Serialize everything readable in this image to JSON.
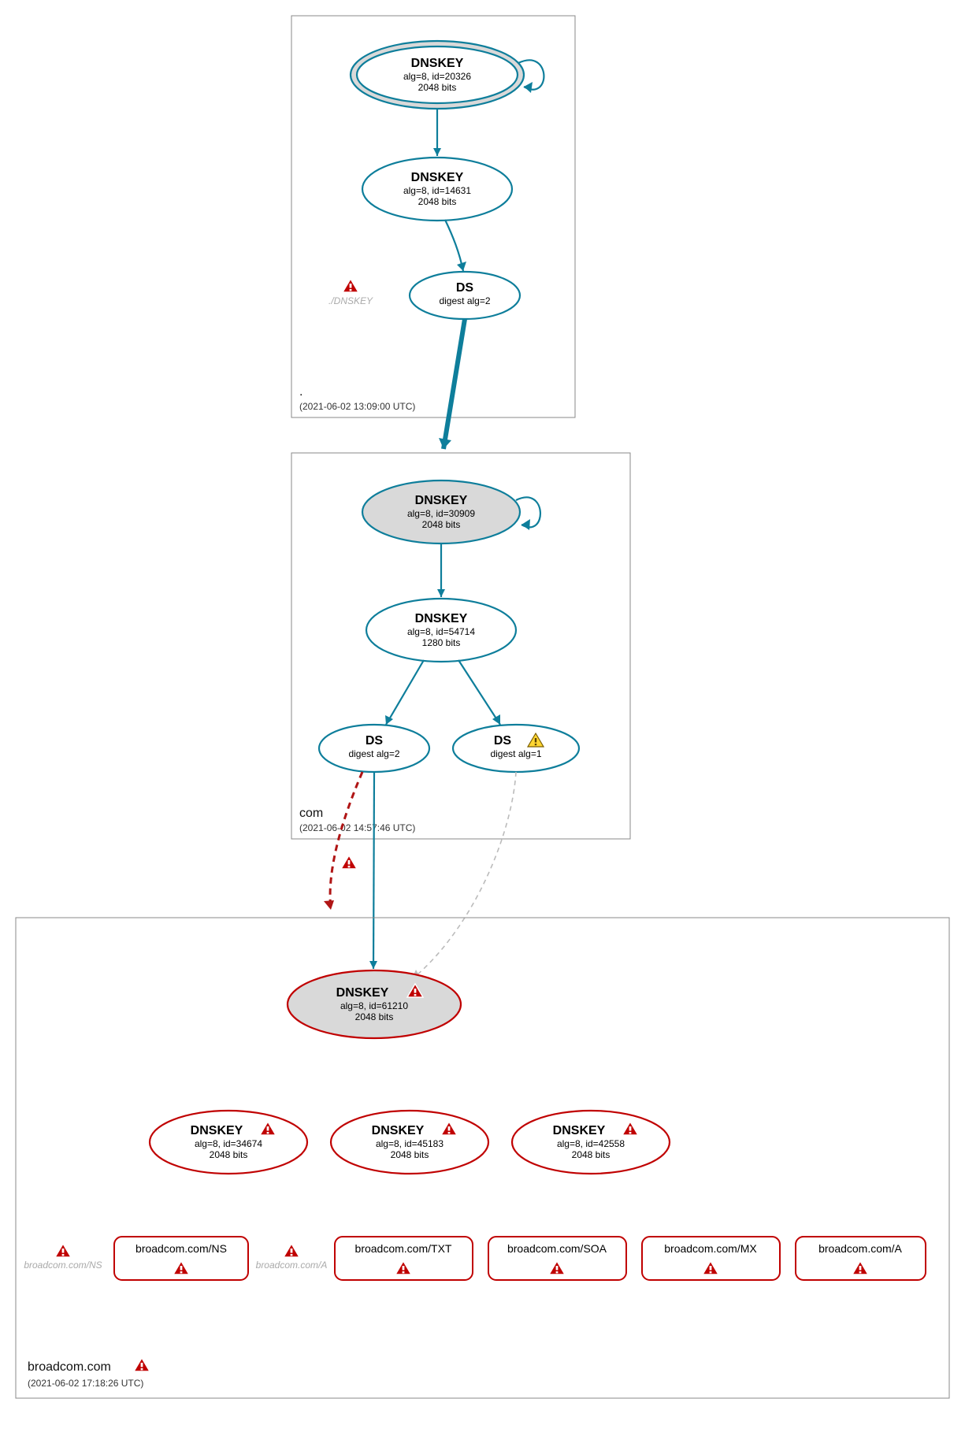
{
  "zones": {
    "root": {
      "name": ".",
      "timestamp": "(2021-06-02 13:09:00 UTC)",
      "nodes": {
        "ksk": {
          "title": "DNSKEY",
          "line1": "alg=8, id=20326",
          "line2": "2048 bits"
        },
        "zsk": {
          "title": "DNSKEY",
          "line1": "alg=8, id=14631",
          "line2": "2048 bits"
        },
        "ds": {
          "title": "DS",
          "line1": "digest alg=2"
        },
        "missing_dnskey": "./DNSKEY"
      }
    },
    "com": {
      "name": "com",
      "timestamp": "(2021-06-02 14:57:46 UTC)",
      "nodes": {
        "ksk": {
          "title": "DNSKEY",
          "line1": "alg=8, id=30909",
          "line2": "2048 bits"
        },
        "zsk": {
          "title": "DNSKEY",
          "line1": "alg=8, id=54714",
          "line2": "1280 bits"
        },
        "ds1": {
          "title": "DS",
          "line1": "digest alg=2"
        },
        "ds2": {
          "title": "DS",
          "line1": "digest alg=1"
        }
      }
    },
    "broadcom": {
      "name": "broadcom.com",
      "timestamp": "(2021-06-02 17:18:26 UTC)",
      "nodes": {
        "ksk": {
          "title": "DNSKEY",
          "line1": "alg=8, id=61210",
          "line2": "2048 bits"
        },
        "k1": {
          "title": "DNSKEY",
          "line1": "alg=8, id=34674",
          "line2": "2048 bits"
        },
        "k2": {
          "title": "DNSKEY",
          "line1": "alg=8, id=45183",
          "line2": "2048 bits"
        },
        "k3": {
          "title": "DNSKEY",
          "line1": "alg=8, id=42558",
          "line2": "2048 bits"
        }
      },
      "records": [
        "broadcom.com/NS",
        "broadcom.com/TXT",
        "broadcom.com/SOA",
        "broadcom.com/MX",
        "broadcom.com/A"
      ],
      "faded": {
        "ns": "broadcom.com/NS",
        "a": "broadcom.com/A"
      }
    }
  },
  "chart_data": {
    "type": "dnssec-auth-graph",
    "zones": [
      {
        "name": ".",
        "timestamp": "2021-06-02 13:09:00 UTC",
        "dnskeys": [
          {
            "id": 20326,
            "algorithm": 8,
            "bits": 2048,
            "role": "KSK",
            "trust_anchor": true,
            "status": "secure"
          },
          {
            "id": 14631,
            "algorithm": 8,
            "bits": 2048,
            "role": "ZSK",
            "status": "secure"
          }
        ],
        "ds": [
          {
            "digest_algorithm": 2,
            "delegates_to": "com",
            "status": "secure"
          }
        ],
        "notes": [
          {
            "type": "error",
            "target": "./DNSKEY"
          }
        ]
      },
      {
        "name": "com",
        "timestamp": "2021-06-02 14:57:46 UTC",
        "dnskeys": [
          {
            "id": 30909,
            "algorithm": 8,
            "bits": 2048,
            "role": "KSK",
            "status": "secure"
          },
          {
            "id": 54714,
            "algorithm": 8,
            "bits": 1280,
            "role": "ZSK",
            "status": "secure"
          }
        ],
        "ds": [
          {
            "digest_algorithm": 2,
            "delegates_to": "broadcom.com",
            "status": "secure"
          },
          {
            "digest_algorithm": 1,
            "delegates_to": "broadcom.com",
            "status": "warning"
          }
        ]
      },
      {
        "name": "broadcom.com",
        "timestamp": "2021-06-02 17:18:26 UTC",
        "status": "error",
        "dnskeys": [
          {
            "id": 61210,
            "algorithm": 8,
            "bits": 2048,
            "role": "KSK",
            "status": "error"
          },
          {
            "id": 34674,
            "algorithm": 8,
            "bits": 2048,
            "status": "error"
          },
          {
            "id": 45183,
            "algorithm": 8,
            "bits": 2048,
            "status": "error"
          },
          {
            "id": 42558,
            "algorithm": 8,
            "bits": 2048,
            "status": "error"
          }
        ],
        "rrsets": [
          {
            "name": "broadcom.com/NS",
            "status": "error"
          },
          {
            "name": "broadcom.com/TXT",
            "status": "error"
          },
          {
            "name": "broadcom.com/SOA",
            "status": "error"
          },
          {
            "name": "broadcom.com/MX",
            "status": "error"
          },
          {
            "name": "broadcom.com/A",
            "status": "error"
          }
        ],
        "notes": [
          {
            "type": "error",
            "target": "broadcom.com/NS"
          },
          {
            "type": "error",
            "target": "broadcom.com/A"
          }
        ],
        "edges_in": [
          {
            "from": "com DS digest_alg=2",
            "status": "secure"
          },
          {
            "from": "com DS digest_alg=2",
            "status": "error-extra"
          },
          {
            "from": "com DS digest_alg=1",
            "status": "ignored"
          }
        ]
      }
    ]
  }
}
